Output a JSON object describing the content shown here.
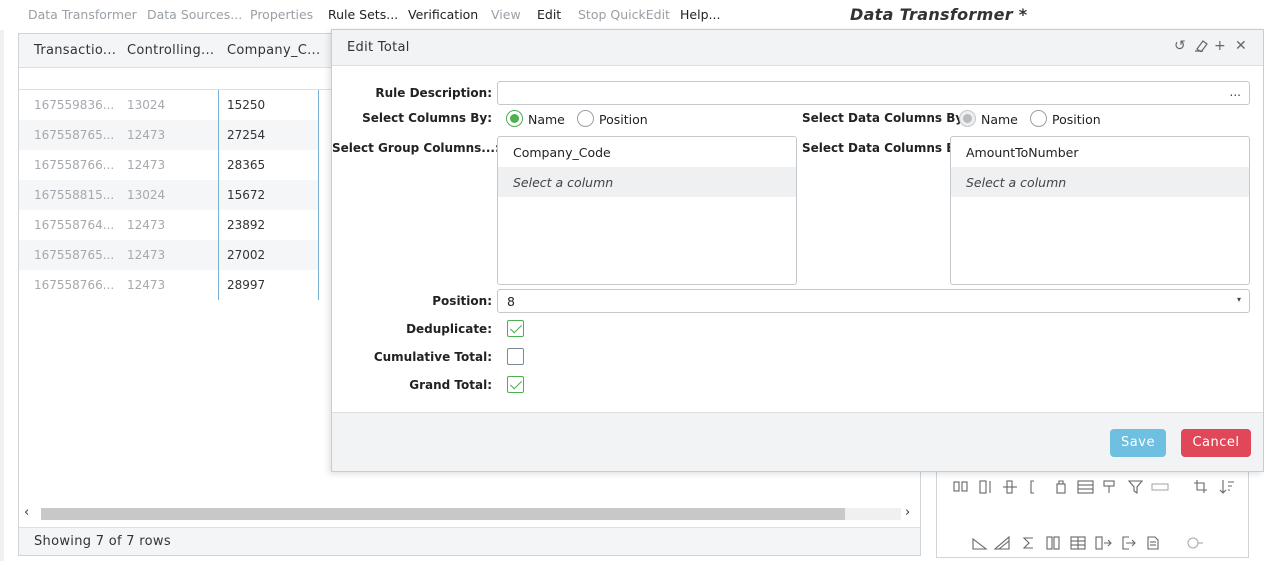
{
  "menu": {
    "items": [
      {
        "label": "Data Transformer",
        "state": "disabled"
      },
      {
        "label": "Data Sources...",
        "state": "disabled"
      },
      {
        "label": "Properties",
        "state": "disabled"
      },
      {
        "label": "Rule Sets...",
        "state": "enabled"
      },
      {
        "label": "Verification",
        "state": "enabled"
      },
      {
        "label": "View",
        "state": "disabled"
      },
      {
        "label": "Edit",
        "state": "enabled"
      },
      {
        "label": "Stop QuickEdit",
        "state": "disabled"
      },
      {
        "label": "Help...",
        "state": "enabled"
      }
    ]
  },
  "app_title": "Data Transformer *",
  "grid": {
    "columns": [
      "Transactio...",
      "Controlling...",
      "Company_C..."
    ],
    "rows": [
      [
        "167559836...",
        "13024",
        "15250"
      ],
      [
        "167558765...",
        "12473",
        "27254"
      ],
      [
        "167558766...",
        "12473",
        "28365"
      ],
      [
        "167558815...",
        "13024",
        "15672"
      ],
      [
        "167558764...",
        "12473",
        "23892"
      ],
      [
        "167558765...",
        "12473",
        "27002"
      ],
      [
        "167558766...",
        "12473",
        "28997"
      ]
    ],
    "footer": "Showing 7 of 7 rows",
    "scroll_left_icon": "chevron-left-icon",
    "scroll_right_icon": "chevron-right-icon"
  },
  "dialog": {
    "title": "Edit Total",
    "header_icons": [
      "undo-icon",
      "eraser-icon",
      "plus-icon",
      "close-icon"
    ],
    "rule_description": {
      "label": "Rule Description:",
      "value": "",
      "ellipsis": "..."
    },
    "select_columns_by": {
      "label": "Select Columns By:",
      "options": [
        "Name",
        "Position"
      ],
      "selected": "Name"
    },
    "select_data_columns_by_radio": {
      "label": "Select Data Columns By:",
      "options": [
        "Name",
        "Position"
      ],
      "selected": "Name",
      "disabled": true
    },
    "group_columns": {
      "label": "Select Group Columns...:",
      "items": [
        "Company_Code"
      ],
      "placeholder": "Select a column"
    },
    "data_columns": {
      "label": "Select Data Columns By:",
      "items": [
        "AmountToNumber"
      ],
      "placeholder": "Select a column"
    },
    "position": {
      "label": "Position:",
      "value": "8"
    },
    "deduplicate": {
      "label": "Deduplicate:",
      "checked": true
    },
    "cumulative_total": {
      "label": "Cumulative Total:",
      "checked": false
    },
    "grand_total": {
      "label": "Grand Total:",
      "checked": true
    },
    "save_label": "Save",
    "cancel_label": "Cancel"
  },
  "toolbar_icons": {
    "row1": [
      "split-column-icon",
      "insert-column-icon",
      "move-column-icon",
      "column-bracket-icon",
      "lock-column-icon",
      "rows-icon",
      "pivot-icon",
      "filter-icon",
      "range-icon",
      "crop-icon",
      "sort-icon"
    ],
    "row2": [
      "slope-icon",
      "triangle-icon",
      "sum-icon",
      "mirror-icon",
      "table-icon",
      "export-column-icon",
      "output-icon",
      "document-icon",
      "refresh-icon"
    ]
  },
  "colors": {
    "accent_green": "#4caf50",
    "save_blue": "#6fbfe0",
    "cancel_red": "#e0485a",
    "selection_blue": "#79b0d8"
  }
}
